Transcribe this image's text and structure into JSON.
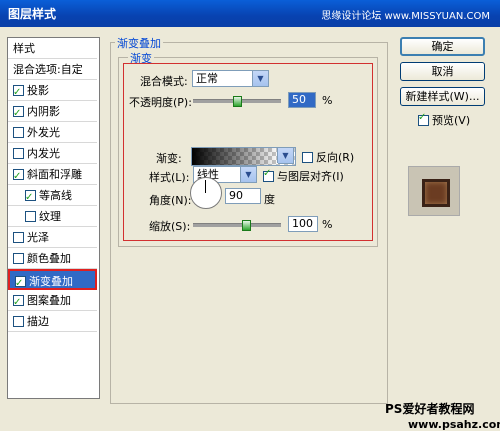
{
  "window": {
    "title": "图层样式",
    "watermark": "思缘设计论坛 www.MISSYUAN.COM"
  },
  "left": {
    "header": "样式",
    "blend_options": "混合选项:自定",
    "items": [
      {
        "label": "投影",
        "checked": true
      },
      {
        "label": "内阴影",
        "checked": true
      },
      {
        "label": "外发光",
        "checked": false
      },
      {
        "label": "内发光",
        "checked": false
      },
      {
        "label": "斜面和浮雕",
        "checked": true
      },
      {
        "label": "等高线",
        "checked": true
      },
      {
        "label": "纹理",
        "checked": false
      },
      {
        "label": "光泽",
        "checked": false
      },
      {
        "label": "颜色叠加",
        "checked": false
      },
      {
        "label": "渐变叠加",
        "checked": true
      },
      {
        "label": "图案叠加",
        "checked": true
      },
      {
        "label": "描边",
        "checked": false
      }
    ]
  },
  "panel": {
    "group_title": "渐变叠加",
    "sub_title": "渐变",
    "blend_mode_label": "混合模式:",
    "blend_mode_value": "正常",
    "opacity_label": "不透明度(P):",
    "opacity_value": "50",
    "opacity_unit": "%",
    "opacity_level": 0.5,
    "gradient_label": "渐变:",
    "reverse_label": "反向(R)",
    "style_label": "样式(L):",
    "style_value": "线性",
    "align_label": "与图层对齐(I)",
    "angle_label": "角度(N):",
    "angle_value": "90",
    "angle_unit": "度",
    "scale_label": "缩放(S):",
    "scale_value": "100",
    "scale_unit": "%"
  },
  "buttons": {
    "ok": "确定",
    "cancel": "取消",
    "new_style": "新建样式(W)...",
    "preview": "预览(V)"
  },
  "watermark": {
    "line1": "PS爱好者教程网",
    "line2": "www.psahz.com"
  }
}
